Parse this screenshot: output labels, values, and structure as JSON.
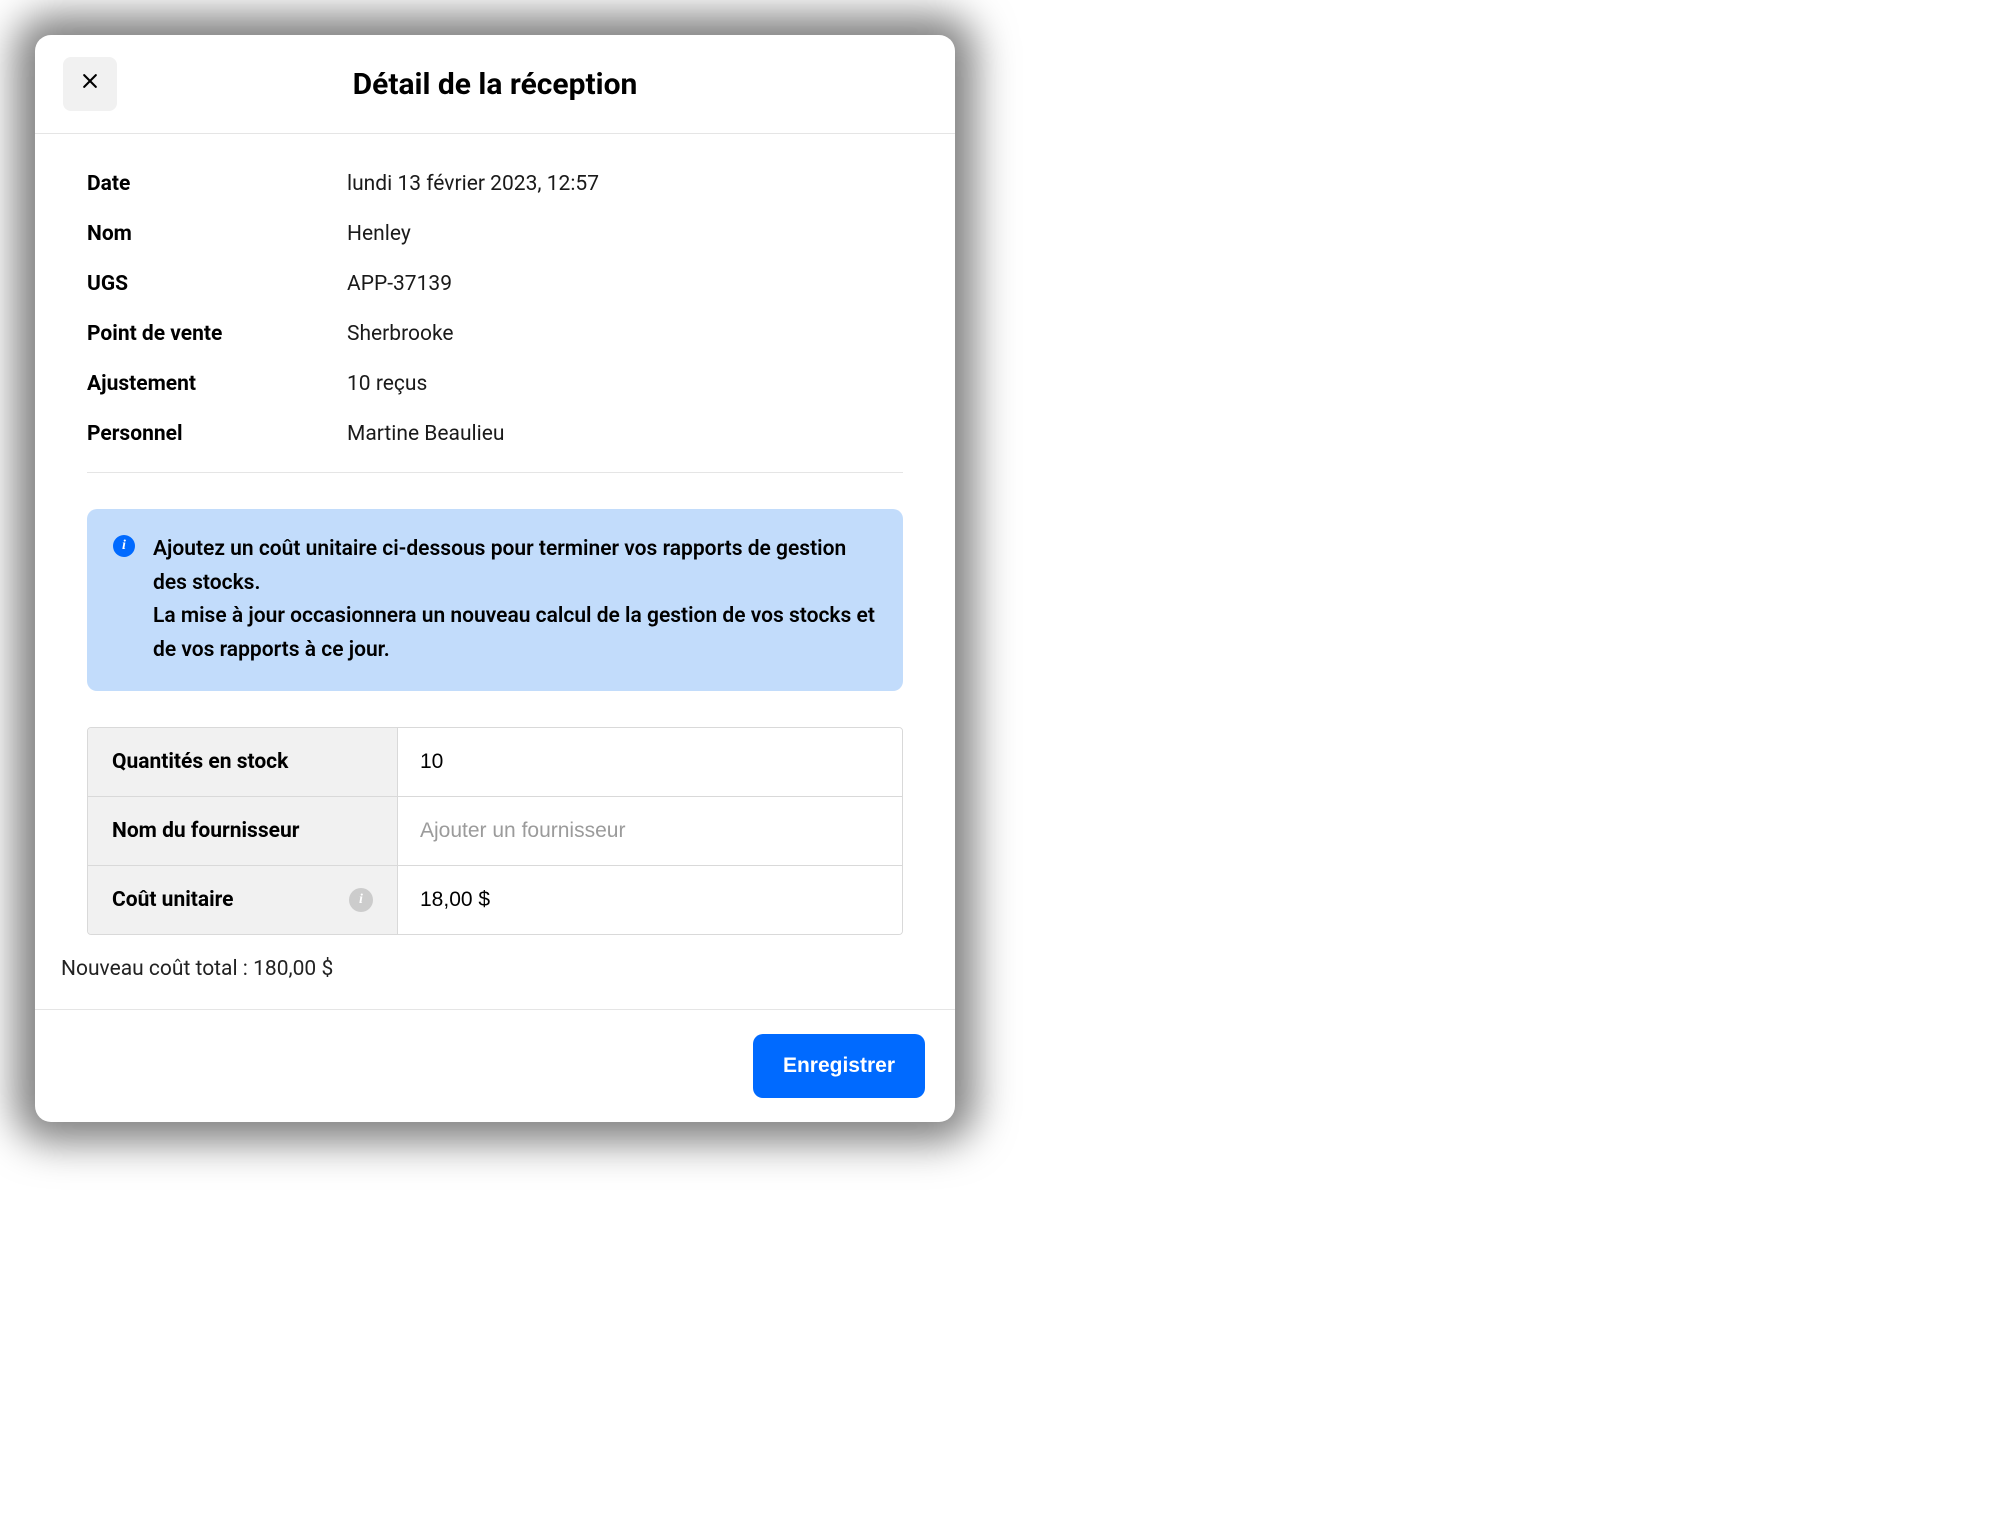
{
  "header": {
    "title": "Détail de la réception"
  },
  "details": {
    "rows": [
      {
        "label": "Date",
        "value": "lundi 13 février 2023, 12:57"
      },
      {
        "label": "Nom",
        "value": "Henley"
      },
      {
        "label": "UGS",
        "value": "APP-37139"
      },
      {
        "label": "Point de vente",
        "value": "Sherbrooke"
      },
      {
        "label": "Ajustement",
        "value": "10 reçus"
      },
      {
        "label": "Personnel",
        "value": "Martine Beaulieu"
      }
    ]
  },
  "info_banner": {
    "line1": "Ajoutez un coût unitaire ci-dessous pour terminer vos rapports de gestion des stocks.",
    "line2": "La mise à jour occasionnera un nouveau calcul de la gestion de vos stocks et de vos rapports à ce jour."
  },
  "form": {
    "stock_label": "Quantités en stock",
    "stock_value": "10",
    "vendor_label": "Nom du fournisseur",
    "vendor_placeholder": "Ajouter un fournisseur",
    "vendor_value": "",
    "unit_cost_label": "Coût unitaire",
    "unit_cost_value": "18,00 $"
  },
  "total": {
    "label": "Nouveau coût total : 180,00 $"
  },
  "footer": {
    "save_label": "Enregistrer"
  }
}
